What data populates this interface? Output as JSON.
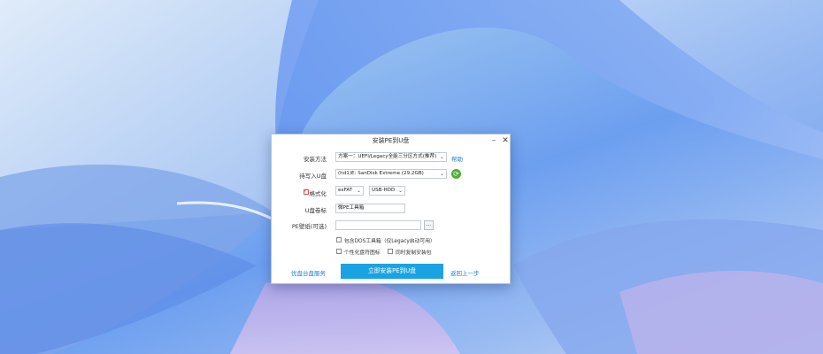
{
  "dialog": {
    "title": "安装PE到U盘",
    "minimize_glyph": "–",
    "close_glyph": "✕"
  },
  "install_method": {
    "label": "安装方法",
    "value": "方案一：UEFI/Legacy全能三分区方式(推荐)",
    "help_link": "帮助"
  },
  "target_disk": {
    "label": "待写入U盘",
    "value": "(hd1)E: SanDisk Extreme (29.2GB)",
    "refresh_icon": "refresh-icon"
  },
  "format": {
    "label": "格式化",
    "checked": true,
    "filesystem": "exFAT",
    "mode": "USB-HDD"
  },
  "volume_label": {
    "label": "U盘卷标",
    "value": "微PE工具箱"
  },
  "wallpaper": {
    "label": "PE壁纸(可选)",
    "value": "",
    "browse_label": "..."
  },
  "options": {
    "include_dos": "包含DOS工具箱（仅Legacy启动可用）",
    "personalize_icon": "个性化盘符图标",
    "copy_installer": "同时复制安装包"
  },
  "footer": {
    "service_link": "优盘台盘服务",
    "install_button": "立即安装PE到U盘",
    "back_link": "返回上一步"
  },
  "colors": {
    "accent": "#1aa3e3",
    "link": "#1b7fd8",
    "refresh": "#4caf32"
  }
}
